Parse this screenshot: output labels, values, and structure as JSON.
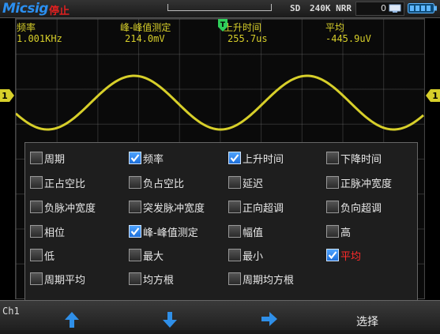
{
  "topbar": {
    "brand": "Micsig",
    "run_state": "停止",
    "acq_mode": "SD",
    "memory_depth": "240K NRR",
    "counter": "0",
    "colors": {
      "brand": "#2b8ff0",
      "run_state": "#e02020"
    },
    "icons": [
      "monitor-icon",
      "battery-icon",
      "trigger-position-marker"
    ]
  },
  "measurements": [
    {
      "name": "频率",
      "value": "1.001KHz"
    },
    {
      "name": "峰-峰值测定",
      "value": "214.0mV"
    },
    {
      "name": "上升时间",
      "value": "255.7us"
    },
    {
      "name": "平均",
      "value": "-445.9uV"
    }
  ],
  "channel": {
    "marker_label": "1",
    "tag": "Ch1",
    "color": "#d7cf2a"
  },
  "trigger_marker_label": "T",
  "menu": {
    "options": [
      {
        "label": "周期",
        "checked": false
      },
      {
        "label": "频率",
        "checked": true
      },
      {
        "label": "上升时间",
        "checked": true
      },
      {
        "label": "下降时间",
        "checked": false
      },
      {
        "label": "正占空比",
        "checked": false
      },
      {
        "label": "负占空比",
        "checked": false
      },
      {
        "label": "延迟",
        "checked": false
      },
      {
        "label": "正脉冲宽度",
        "checked": false
      },
      {
        "label": "负脉冲宽度",
        "checked": false
      },
      {
        "label": "突发脉冲宽度",
        "checked": false
      },
      {
        "label": "正向超调",
        "checked": false
      },
      {
        "label": "负向超调",
        "checked": false
      },
      {
        "label": "相位",
        "checked": false
      },
      {
        "label": "峰-峰值测定",
        "checked": true
      },
      {
        "label": "幅值",
        "checked": false
      },
      {
        "label": "高",
        "checked": false
      },
      {
        "label": "低",
        "checked": false
      },
      {
        "label": "最大",
        "checked": false
      },
      {
        "label": "最小",
        "checked": false
      },
      {
        "label": "平均",
        "checked": true
      },
      {
        "label": "周期平均",
        "checked": false
      },
      {
        "label": "均方根",
        "checked": false
      },
      {
        "label": "周期均方根",
        "checked": false
      }
    ],
    "highlight_color": "#ff2a2a"
  },
  "softkeys": {
    "icons": [
      "arrow-up-icon",
      "arrow-down-icon",
      "arrow-right-icon"
    ],
    "select_label": "选择",
    "icon_color": "#2f8fe8"
  }
}
